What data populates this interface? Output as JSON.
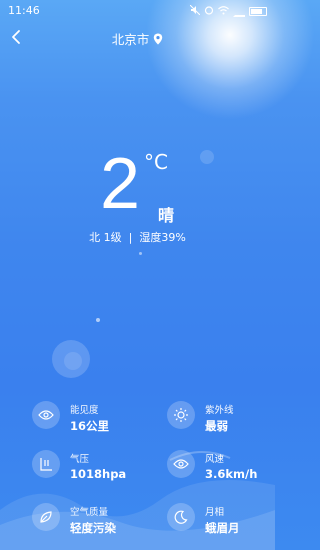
{
  "status_bar": {
    "time": "11:46"
  },
  "header": {
    "city": "北京市"
  },
  "weather": {
    "temperature": "2",
    "unit": "°C",
    "condition": "晴",
    "wind": "北 1级",
    "separator": "|",
    "humidity": "湿度39%"
  },
  "stats": [
    {
      "label": "能见度",
      "value": "16公里",
      "icon": "eye-icon"
    },
    {
      "label": "紫外线",
      "value": "最弱",
      "icon": "sun-icon"
    },
    {
      "label": "气压",
      "value": "1018hpa",
      "icon": "pressure-icon"
    },
    {
      "label": "风速",
      "value": "3.6km/h",
      "icon": "eye-icon"
    },
    {
      "label": "空气质量",
      "value": "轻度污染",
      "icon": "leaf-icon"
    },
    {
      "label": "月相",
      "value": "蛾眉月",
      "icon": "moon-icon"
    }
  ]
}
